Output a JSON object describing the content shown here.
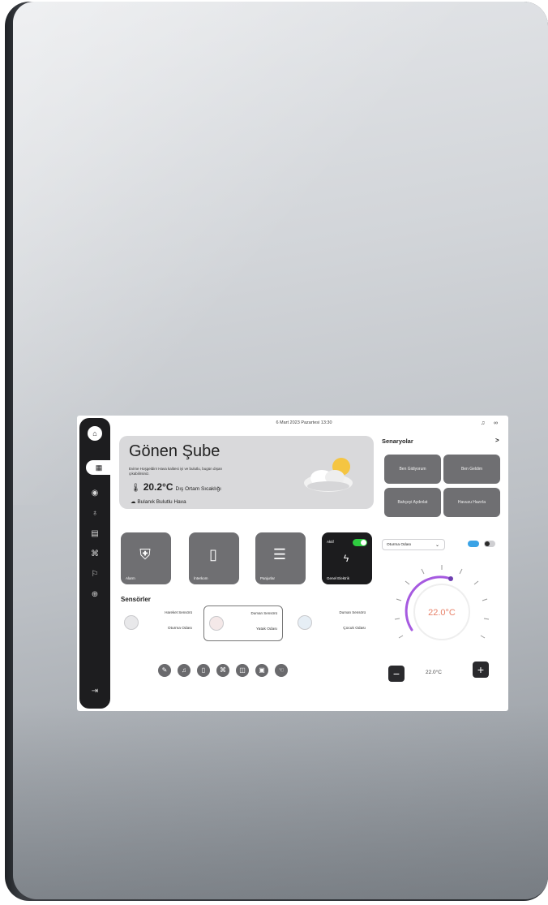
{
  "header": {
    "date_time": "6 Mart 2023 Pazartesi 13:30"
  },
  "greeting": {
    "title": "Gönen Şube",
    "subtitle": "Evime Hoşgeldin! Hava kalitesi iyi ve bulutlu, bugün dışarı çıkabilirsiniz.",
    "temperature": "20.2°C",
    "temperature_label": "Dış Ortam Sıcaklığı",
    "weather": "Bulanık Bulutlu Hava"
  },
  "tiles": [
    {
      "label": "Alarm",
      "icon": "shield-icon"
    },
    {
      "label": "İnterkom",
      "icon": "intercom-icon"
    },
    {
      "label": "Panjurlar",
      "icon": "blinds-icon"
    },
    {
      "label": "Genel Elektrik",
      "status": "Aktif",
      "icon": "power-icon"
    }
  ],
  "sensors": {
    "title": "Sensörler",
    "items": [
      {
        "name": "Hareket Sensörü",
        "room": "Oturma Odası"
      },
      {
        "name": "Duman Sensörü",
        "room": "Yatak Odası"
      },
      {
        "name": "Duman Sensörü",
        "room": "Çocuk Odası"
      }
    ]
  },
  "scenarios": {
    "title": "Senaryolar",
    "arrow": ">",
    "items": [
      "Ben Gidiyorum",
      "Ben Geldim",
      "Bahçeyi Aydınlat",
      "Havuzu Hazırla"
    ]
  },
  "climate": {
    "room": "Oturma Odası",
    "current_temp": "22.0°C",
    "set_temp": "22.0°C",
    "minus": "−",
    "plus": "+"
  },
  "colors": {
    "accent_purple": "#a65ae0",
    "toggle_green": "#2ecc40",
    "mode_blue": "#3aa3e6",
    "temp_orange": "#e8826a"
  }
}
